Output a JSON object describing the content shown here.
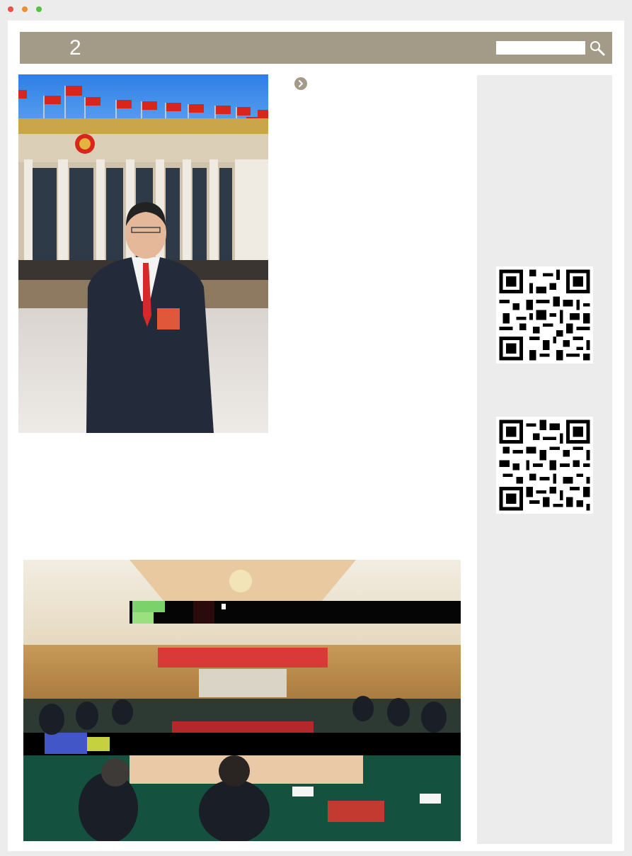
{
  "window": {
    "controls": [
      "close",
      "minimize",
      "maximize"
    ]
  },
  "header": {
    "number": "2",
    "background_color": "#a39a88"
  },
  "search": {
    "value": "",
    "placeholder": "",
    "icon": "magnifier-icon"
  },
  "article": {
    "bullet_icon": "circle-chevron-right-icon",
    "portrait_photo": "photo",
    "meeting_photo": "photo"
  },
  "sidebar": {
    "qr_codes": [
      "qr-code",
      "qr-code"
    ]
  }
}
